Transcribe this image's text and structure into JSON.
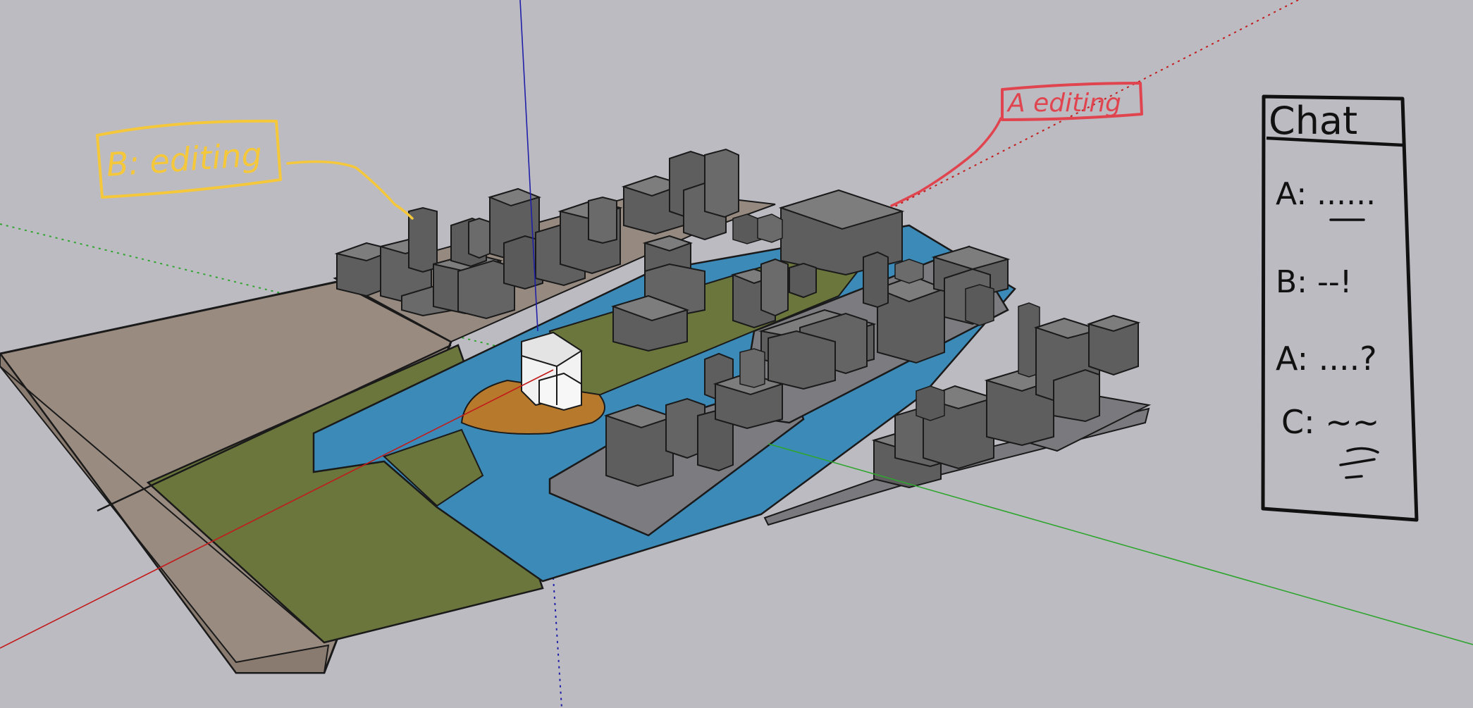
{
  "viewport": {
    "background": "#bdbbc2"
  },
  "annotations": {
    "b_editing": {
      "text": "B: editing",
      "color": "#f5c83c"
    },
    "a_editing": {
      "text": "A editing",
      "color": "#e0454f"
    }
  },
  "chat_panel": {
    "title": "Chat",
    "messages": [
      {
        "speaker": "A",
        "text": "A: ......"
      },
      {
        "speaker": "B",
        "text": "B: --!"
      },
      {
        "speaker": "A",
        "text": "A: ....?"
      },
      {
        "speaker": "C",
        "text": "C: ~~"
      }
    ]
  },
  "colors": {
    "ground_tan": "#9a8b80",
    "grass": "#6a763b",
    "water": "#3b8ab8",
    "plaza": "#7c7c80",
    "building_top": "#7d7d7d",
    "building_left": "#5e5e5e",
    "building_right": "#6d6d6d",
    "sand": "#b77a2c",
    "house": "#f2f2f2",
    "axis_red": "#c21b1b",
    "axis_green": "#2fa52f",
    "axis_blue": "#1f1fa8"
  }
}
